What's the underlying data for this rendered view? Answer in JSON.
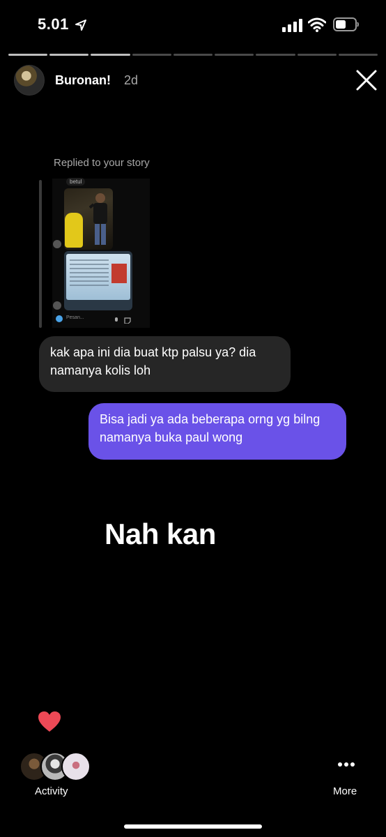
{
  "status_bar": {
    "time": "5.01"
  },
  "story": {
    "segments_total": 9,
    "segments_viewed": 3
  },
  "header": {
    "username": "Buronan!",
    "time_ago": "2d"
  },
  "reply": {
    "label": "Replied to your story",
    "preview": {
      "top_label": "betul",
      "message_placeholder": "Pesan..."
    }
  },
  "messages": [
    {
      "direction": "incoming",
      "text": "kak apa ini dia buat ktp palsu ya? dia namanya kolis loh"
    },
    {
      "direction": "outgoing",
      "text": "Bisa jadi ya ada beberapa orng yg bilng namanya buka paul wong"
    }
  ],
  "sticker_text": "Nah kan",
  "footer": {
    "activity_label": "Activity",
    "more_label": "More"
  },
  "colors": {
    "outgoing_bubble": "#6a52e8",
    "incoming_bubble": "#262626",
    "heart": "#ed4956"
  },
  "icons": [
    "location-arrow-icon",
    "signal-icon",
    "wifi-icon",
    "battery-icon",
    "close-icon",
    "heart-icon",
    "more-icon"
  ]
}
